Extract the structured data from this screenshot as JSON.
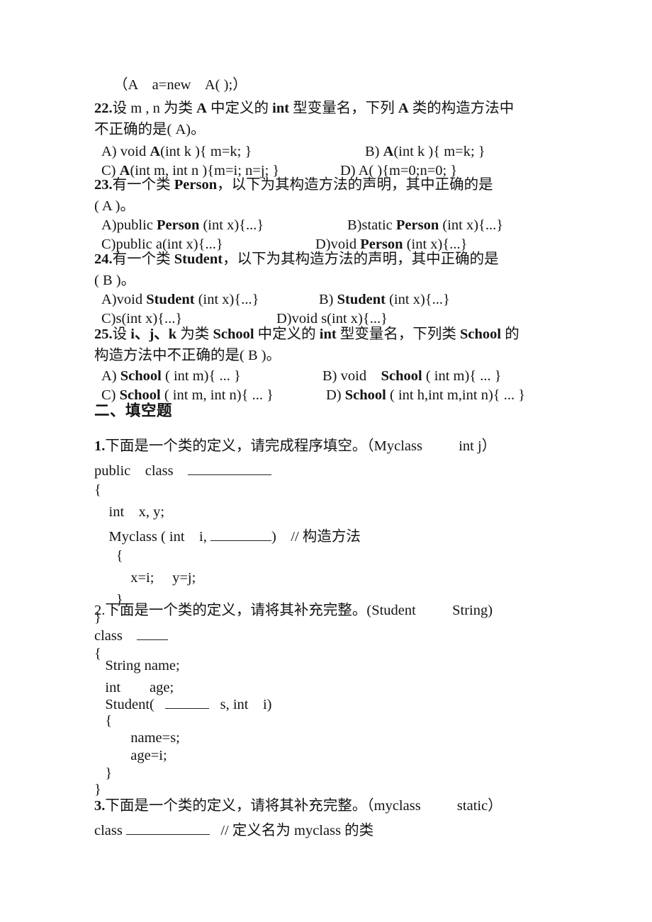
{
  "document": {
    "intro_line": "（A    a=new    A( );）",
    "multiple_choice": [
      {
        "number": "22.",
        "stem_line1_a": "设 m , n 为类 ",
        "stem_line1_b": "A",
        "stem_line1_c": " 中定义的 ",
        "stem_line1_d": "int",
        "stem_line1_e": " 型变量名，下列 ",
        "stem_line1_f": "A",
        "stem_line1_g": " 类的构造方法中",
        "stem_line2": "不正确的是( A)。",
        "options": [
          {
            "key": "A) void ",
            "bold": "A",
            "rest": "(int k ){ m=k; }"
          },
          {
            "key": "B) ",
            "bold": "A",
            "rest": "(int k ){ m=k; }"
          },
          {
            "key": "C) ",
            "bold": "A",
            "rest": "(int m, int n ){m=i; n=j; }"
          },
          {
            "key": "D) A( ){m=0;n=0; }",
            "bold": "",
            "rest": ""
          }
        ]
      },
      {
        "number": "23.",
        "stem_line1_a": "有一个类 ",
        "stem_line1_b": "Person",
        "stem_line1_c": "，以下为其构造方法的声明，其中正确的是",
        "stem_line2": "( A )。",
        "options": [
          {
            "key": "A)public ",
            "bold": "Person",
            "rest": " (int x){...}"
          },
          {
            "key": "B)static ",
            "bold": "Person",
            "rest": " (int x){...}"
          },
          {
            "key": "C)public a(int x){...}",
            "bold": "",
            "rest": ""
          },
          {
            "key": "D)void ",
            "bold": "Person",
            "rest": " (int x){...}"
          }
        ]
      },
      {
        "number": "24.",
        "stem_line1_a": "有一个类 ",
        "stem_line1_b": "Student",
        "stem_line1_c": "，以下为其构造方法的声明，其中正确的是",
        "stem_line2": "( B )。",
        "options": [
          {
            "key": "A)void ",
            "bold": "Student",
            "rest": " (int x){...}"
          },
          {
            "key": "B) ",
            "bold": "Student",
            "rest": " (int x){...}"
          },
          {
            "key": "C)s(int x){...}",
            "bold": "",
            "rest": ""
          },
          {
            "key": "D)void s(int x){...}",
            "bold": "",
            "rest": ""
          }
        ]
      },
      {
        "number": "25.",
        "stem_line1_a": "设 ",
        "stem_line1_b": "i、j、k",
        "stem_line1_c": " 为类 ",
        "stem_line1_d": "School",
        "stem_line1_e": " 中定义的 ",
        "stem_line1_f": "int",
        "stem_line1_g": " 型变量名，下列类 ",
        "stem_line1_h": "School",
        "stem_line1_i": " 的",
        "stem_line2": "构造方法中不正确的是( B )。",
        "options": [
          {
            "key": "A) ",
            "bold": "School",
            "rest": " ( int m){ ... }"
          },
          {
            "key": "B) void    ",
            "bold": "School",
            "rest": " ( int m){ ... }"
          },
          {
            "key": "C) ",
            "bold": "School",
            "rest": " ( int m, int n){ ... }"
          },
          {
            "key": "D) ",
            "bold": "School",
            "rest": " ( int h,int m,int n){ ... }"
          }
        ]
      }
    ],
    "section2_heading": "二、填空题",
    "fill_in_blanks": [
      {
        "number": "1.",
        "prompt": "下面是一个类的定义，请完成程序填空。（Myclass          int j）",
        "code": {
          "l1_pre": "public    class    ",
          "l2": "{",
          "l3": "    int    x, y;",
          "l4_pre": "    Myclass ( int    i, ",
          "l4_post": ")    // 构造方法",
          "l5": "      {",
          "l6": "          x=i;     y=j;",
          "l7": "      }",
          "l8": "}"
        }
      },
      {
        "number": "2.",
        "prompt": "下面是一个类的定义，请将其补充完整。(Student          String)",
        "code": {
          "l1_pre": "class    ",
          "l2": "{",
          "l3": "   String name;",
          "l4": "   int        age;",
          "l5_pre": "   Student(   ",
          "l5_post": "   s, int    i)",
          "l6": "   {",
          "l7": "          name=s;",
          "l8": "          age=i;",
          "l9": "   }",
          "l10": "}"
        }
      },
      {
        "number": "3.",
        "prompt": "下面是一个类的定义，请将其补充完整。（myclass          static）",
        "code": {
          "l1_pre": "class ",
          "l1_post": "   // 定义名为 myclass 的类"
        }
      }
    ]
  }
}
